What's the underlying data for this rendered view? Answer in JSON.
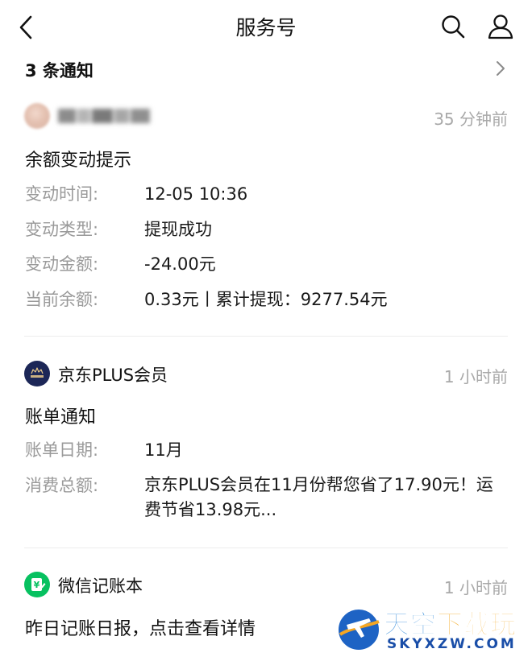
{
  "header": {
    "title": "服务号",
    "back_icon": "chevron-left-icon",
    "search_icon": "search-icon",
    "profile_icon": "user-icon"
  },
  "notice_bar": {
    "label": "3 条通知",
    "chevron_icon": "chevron-right-icon"
  },
  "messages": [
    {
      "sender": "",
      "sender_blurred": true,
      "time": "35 分钟前",
      "title": "余额变动提示",
      "rows": [
        {
          "key": "变动时间:",
          "value": "12-05 10:36"
        },
        {
          "key": "变动类型:",
          "value": "提现成功"
        },
        {
          "key": "变动金额:",
          "value": "-24.00元"
        },
        {
          "key": "当前余额:",
          "value": "0.33元丨累计提现：9277.54元"
        }
      ]
    },
    {
      "sender": "京东PLUS会员",
      "time": "1 小时前",
      "title": "账单通知",
      "avatar_icon": "jd-plus-crown-icon",
      "rows": [
        {
          "key": "账单日期:",
          "value": "11月"
        },
        {
          "key": "消费总额:",
          "value": "京东PLUS会员在11月份帮您省了17.90元！运费节省13.98元..."
        }
      ]
    },
    {
      "sender": "微信记账本",
      "time": "1 小时前",
      "title": "昨日记账日报，点击查看详情",
      "avatar_icon": "ledger-yuan-icon"
    }
  ],
  "watermark": {
    "main_part1": "天空",
    "main_part2": "下载玩",
    "sub": "SKYXZW.COM"
  },
  "colors": {
    "accent_green": "#07c160",
    "muted_text": "#9a9a9a",
    "time_text": "#a9a9a9",
    "jd_navy": "#1c2757"
  }
}
